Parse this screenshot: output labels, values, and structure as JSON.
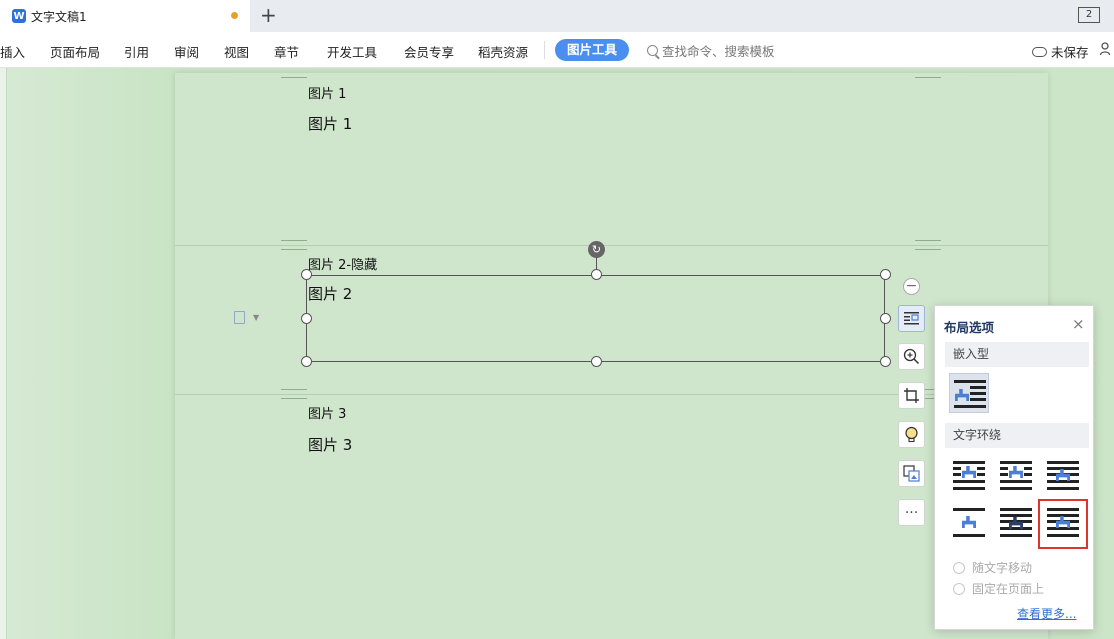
{
  "titlebar": {
    "app_icon_letter": "W",
    "doc_name": "文字文稿1",
    "new_tab": "+",
    "window_control": "2"
  },
  "menubar": {
    "items": [
      "插入",
      "页面布局",
      "引用",
      "审阅",
      "视图",
      "章节",
      "开发工具",
      "会员专享",
      "稻壳资源"
    ],
    "active_tool": "图片工具",
    "search_placeholder": "查找命令、搜索模板",
    "save_status": "未保存"
  },
  "document": {
    "lines": [
      {
        "small": "图片 1",
        "large": "图片 1"
      },
      {
        "small": "图片 2-隐藏",
        "large": "图片 2"
      },
      {
        "small": "图片 3",
        "large": "图片 3"
      }
    ]
  },
  "side_toolbar": {
    "icons": [
      "collapse-icon",
      "layout-options-icon",
      "zoom-in-icon",
      "crop-icon",
      "idea-icon",
      "replace-image-icon",
      "more-icon"
    ],
    "more_label": "···"
  },
  "layout_panel": {
    "title": "布局选项",
    "close": "×",
    "inline_section": "嵌入型",
    "wrap_section": "文字环绕",
    "radio_move_with_text": "随文字移动",
    "radio_fix_on_page": "固定在页面上",
    "more_link": "查看更多...",
    "selected_option": "inline",
    "highlighted_option": "in-front-of-text"
  },
  "colors": {
    "accent": "#4a8ef0",
    "page_bg": "#cfe6cc",
    "highlight": "#e0342a",
    "figure": "#4a7fd4"
  }
}
